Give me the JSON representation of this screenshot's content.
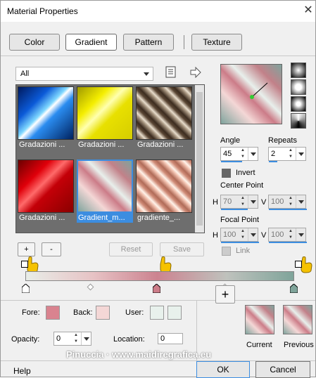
{
  "window": {
    "title": "Material Properties",
    "close_glyph": "✕"
  },
  "tabs": [
    {
      "label": "Color",
      "active": false
    },
    {
      "label": "Gradient",
      "active": true
    },
    {
      "label": "Pattern",
      "active": false
    },
    {
      "label": "Texture",
      "active": false
    }
  ],
  "category": {
    "selected": "All"
  },
  "presets": [
    {
      "label": "Gradazioni ...",
      "selected": false
    },
    {
      "label": "Gradazioni ...",
      "selected": false
    },
    {
      "label": "Gradazioni ...",
      "selected": false
    },
    {
      "label": "Gradazioni ...",
      "selected": false
    },
    {
      "label": "Gradient_m...",
      "selected": true
    },
    {
      "label": "gradiente_...",
      "selected": false
    }
  ],
  "preset_buttons": {
    "add": "+",
    "remove": "-",
    "reset": "Reset",
    "save": "Save"
  },
  "angle": {
    "label": "Angle",
    "value": "45"
  },
  "repeats": {
    "label": "Repeats",
    "value": "2"
  },
  "invert": {
    "label": "Invert",
    "checked": true
  },
  "center_point": {
    "label": "Center Point",
    "h_label": "H",
    "h_value": "70",
    "v_label": "V",
    "v_value": "100"
  },
  "focal_point": {
    "label": "Focal Point",
    "h_label": "H",
    "h_value": "100",
    "v_label": "V",
    "v_value": "100"
  },
  "link": {
    "label": "Link",
    "checked": false
  },
  "colors": {
    "fore_label": "Fore:",
    "back_label": "Back:",
    "user_label": "User:",
    "fore": "#d9838f",
    "back": "#f4d7d6",
    "user1": "#e8f1ec",
    "user2": "#e8f1ec",
    "stop_left": "#ffffff",
    "stop_mid": "#cc7c88",
    "stop_right": "#7fa49a"
  },
  "opacity": {
    "label": "Opacity:",
    "value": "0"
  },
  "location": {
    "label": "Location:",
    "value": "0"
  },
  "material": {
    "add": "+",
    "current_label": "Current",
    "previous_label": "Previous"
  },
  "footer": {
    "help": "Help",
    "ok": "OK",
    "cancel": "Cancel"
  },
  "watermark": "Pinuccia · www.maidiregrafica.eu"
}
